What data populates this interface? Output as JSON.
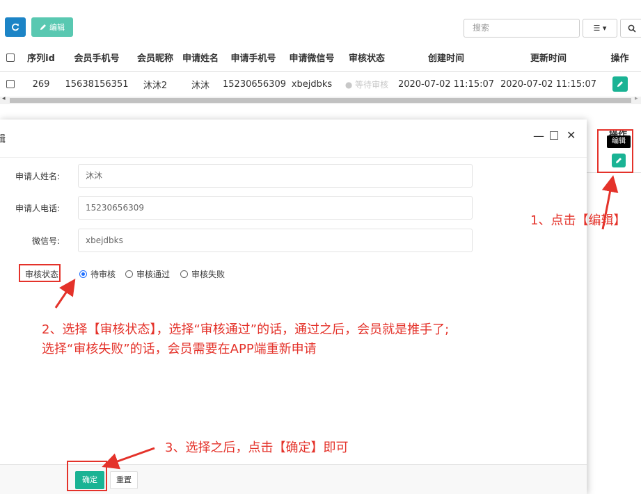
{
  "toolbar": {
    "refresh_icon": "refresh-icon",
    "edit_label": "编辑",
    "search_placeholder": "搜索",
    "columns_icon": "columns-icon",
    "search_icon": "search-icon"
  },
  "table": {
    "headers": [
      "序列id",
      "会员手机号",
      "会员昵称",
      "申请姓名",
      "申请手机号",
      "申请微信号",
      "审核状态",
      "创建时间",
      "更新时间",
      "操作"
    ],
    "rows": [
      {
        "id": "269",
        "member_phone": "15638156351",
        "nickname": "沐沐2",
        "name": "沐沐",
        "phone": "15230656309",
        "wechat": "xbejdbks",
        "status": "● 等待审核",
        "created": "2020-07-02 11:15:07",
        "updated": "2020-07-02 11:15:07"
      }
    ]
  },
  "right_panel": {
    "header": "操作",
    "tooltip": "编辑"
  },
  "dialog": {
    "title": "辑",
    "fields": [
      {
        "label": "申请人姓名:",
        "value": "沐沐"
      },
      {
        "label": "申请人电话:",
        "value": "15230656309"
      },
      {
        "label": "微信号:",
        "value": "xbejdbks"
      }
    ],
    "status_label": "审核状态:",
    "status_options": [
      "待审核",
      "审核通过",
      "审核失败"
    ],
    "selected_status": "待审核",
    "confirm_label": "确定",
    "reset_label": "重置"
  },
  "annotations": {
    "step1": "1、点击【编辑】",
    "step2_line1": "2、选择【审核状态】，选择“审核通过”的话，通过之后，会员就是推手了;",
    "step2_line2": "选择“审核失败”的话，会员需要在APP端重新申请",
    "step3": "3、选择之后，点击【确定】即可"
  },
  "colors": {
    "primary": "#1e6fff",
    "success": "#1ab394",
    "annotation": "#e4322a"
  }
}
